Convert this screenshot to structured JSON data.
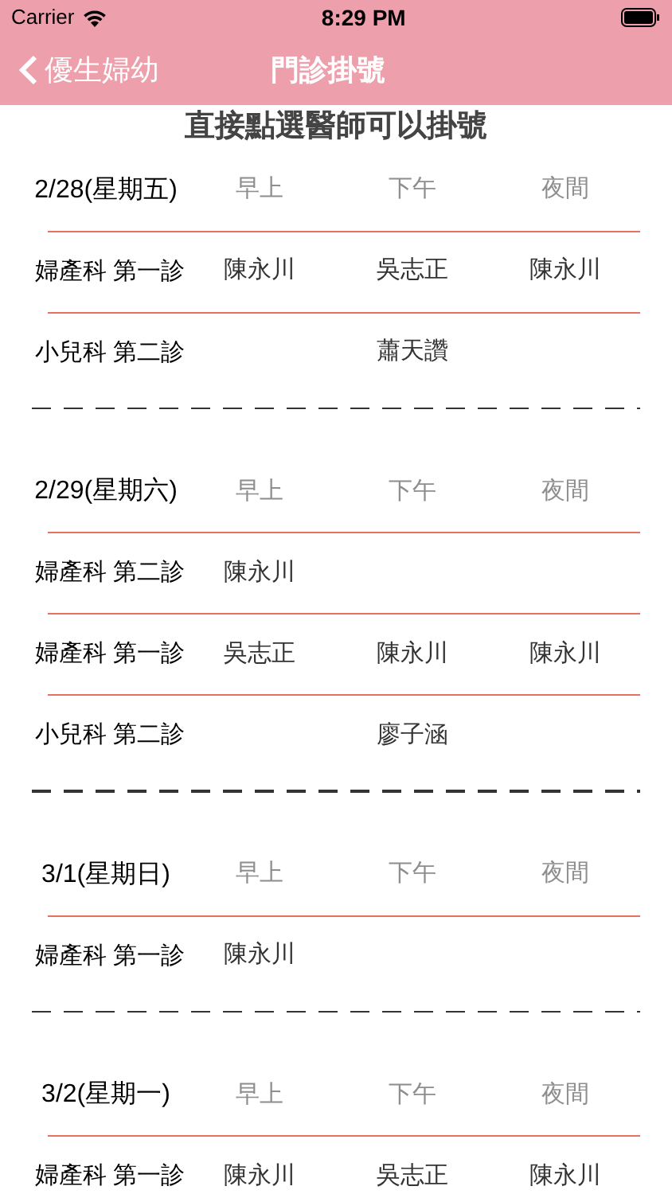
{
  "status_bar": {
    "carrier": "Carrier",
    "time": "8:29 PM"
  },
  "nav": {
    "back_label": "優生婦幼",
    "title": "門診掛號"
  },
  "instruction": "直接點選醫師可以掛號",
  "days": [
    {
      "date": "2/28(星期五)",
      "slots": [
        "早上",
        "下午",
        "夜間"
      ],
      "rows": [
        {
          "dept": "婦產科 第一診",
          "doctors": {
            "morning": "陳永川",
            "afternoon": "吳志正",
            "evening": "陳永川"
          }
        },
        {
          "dept": "小兒科 第二診",
          "doctors": {
            "afternoon": "蕭天讚"
          }
        }
      ]
    },
    {
      "date": "2/29(星期六)",
      "slots": [
        "早上",
        "下午",
        "夜間"
      ],
      "rows": [
        {
          "dept": "婦產科 第二診",
          "doctors": {
            "morning": "陳永川"
          }
        },
        {
          "dept": "婦產科 第一診",
          "doctors": {
            "morning": "吳志正",
            "afternoon": "陳永川",
            "evening": "陳永川"
          }
        },
        {
          "dept": "小兒科 第二診",
          "doctors": {
            "afternoon": "廖子涵"
          }
        }
      ]
    },
    {
      "date": "3/1(星期日)",
      "slots": [
        "早上",
        "下午",
        "夜間"
      ],
      "rows": [
        {
          "dept": "婦產科 第一診",
          "doctors": {
            "morning": "陳永川"
          }
        }
      ]
    },
    {
      "date": "3/2(星期一)",
      "slots": [
        "早上",
        "下午",
        "夜間"
      ],
      "rows": [
        {
          "dept": "婦產科 第一診",
          "doctors": {
            "morning": "陳永川",
            "afternoon": "吳志正",
            "evening": "陳永川"
          }
        }
      ]
    }
  ]
}
